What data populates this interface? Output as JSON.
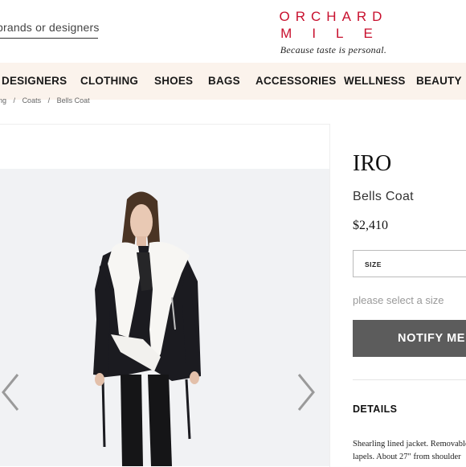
{
  "header": {
    "search_text": "brands or designers",
    "logo_line1": "ORCHARD",
    "logo_line2": "MILE",
    "tagline": "Because taste is personal."
  },
  "nav": {
    "items": [
      "DESIGNERS",
      "CLOTHING",
      "SHOES",
      "BAGS",
      "ACCESSORIES",
      "WELLNESS",
      "BEAUTY"
    ]
  },
  "breadcrumb": {
    "items": [
      "ng",
      "/",
      "Coats",
      "/",
      "Bells Coat"
    ]
  },
  "product": {
    "brand": "IRO",
    "name": "Bells Coat",
    "price": "$2,410",
    "size_label": "SIZE",
    "size_hint": "please select a size",
    "notify_label": "NOTIFY ME",
    "details_heading": "DETAILS",
    "description_line1": "Shearling lined jacket. Removable",
    "description_line2": "lapels. About 27\" from shoulder"
  },
  "gallery": {
    "prev_icon": "chevron-left-icon",
    "next_icon": "chevron-right-icon"
  },
  "colors": {
    "brand_red": "#c8102e",
    "nav_bg": "#fbf3ec",
    "button_bg": "#5c5c5c"
  }
}
